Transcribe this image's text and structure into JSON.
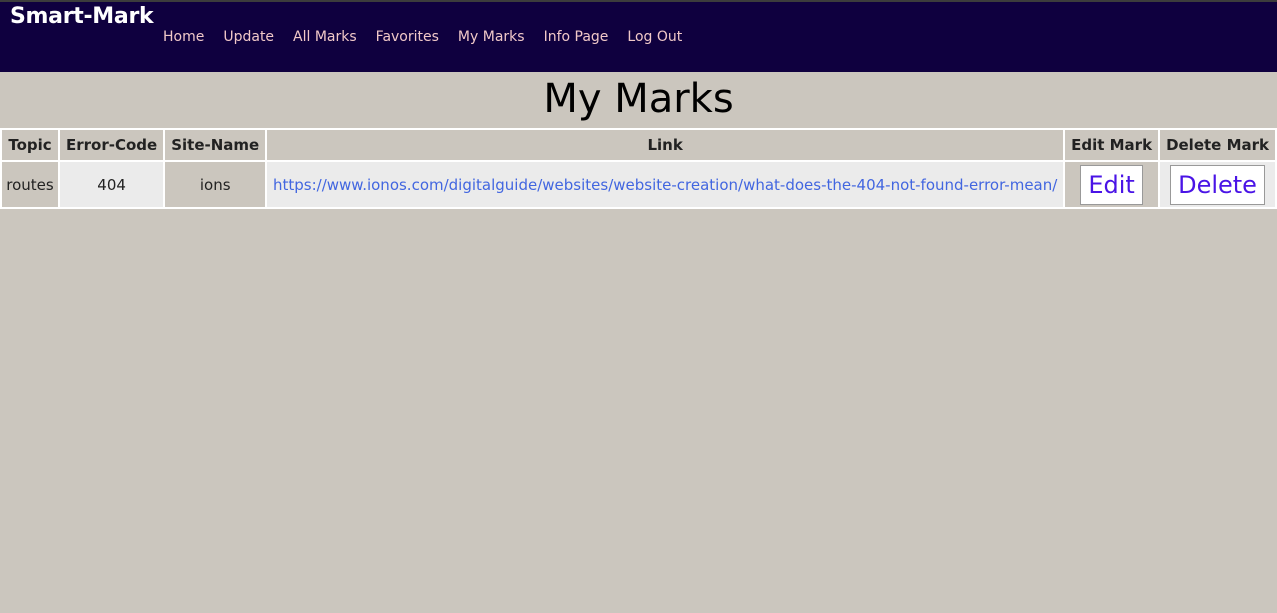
{
  "app": {
    "brand": "Smart-Mark"
  },
  "nav": {
    "items": [
      {
        "label": "Home"
      },
      {
        "label": "Update"
      },
      {
        "label": "All Marks"
      },
      {
        "label": "Favorites"
      },
      {
        "label": "My Marks"
      },
      {
        "label": "Info Page"
      },
      {
        "label": "Log Out"
      }
    ]
  },
  "page": {
    "title": "My Marks"
  },
  "table": {
    "headers": [
      "Topic",
      "Error-Code",
      "Site-Name",
      "Link",
      "Edit Mark",
      "Delete Mark"
    ],
    "rows": [
      {
        "topic": "routes",
        "error_code": "404",
        "site_name": "ions",
        "link": "https://www.ionos.com/digitalguide/websites/website-creation/what-does-the-404-not-found-error-mean/",
        "edit_label": "Edit",
        "delete_label": "Delete"
      }
    ]
  },
  "colors": {
    "topbar": "#0f003f",
    "background": "#cbc6be",
    "nav_link": "#f0c8c8",
    "link": "#4266e0",
    "button_text": "#4a14e6"
  }
}
